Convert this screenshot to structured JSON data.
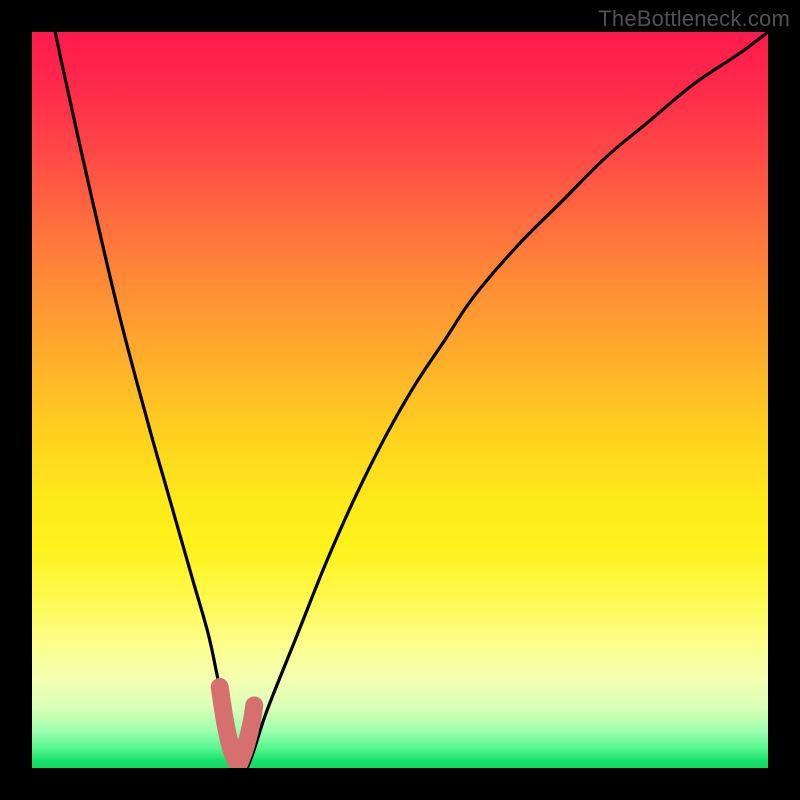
{
  "watermark": "TheBottleneck.com",
  "colors": {
    "frame": "#000000",
    "curve": "#000000",
    "highlight": "#d6706f",
    "gradient_top": "#ff1a4d",
    "gradient_bottom": "#0fdc63"
  },
  "chart_data": {
    "type": "line",
    "title": "",
    "xlabel": "",
    "ylabel": "",
    "xlim": [
      0,
      100
    ],
    "ylim": [
      0,
      100
    ],
    "grid": false,
    "x": [
      0,
      4,
      8,
      12,
      16,
      18,
      20,
      22,
      24,
      25.5,
      27,
      28,
      29,
      30,
      32,
      36,
      40,
      44,
      48,
      52,
      56,
      60,
      66,
      72,
      78,
      84,
      90,
      96,
      100
    ],
    "series": [
      {
        "name": "bottleneck_curve",
        "values": [
          115,
          96,
          78,
          61,
          46,
          39,
          32,
          25,
          18,
          11,
          5,
          2,
          0,
          2,
          8,
          18,
          28,
          37,
          45,
          52,
          58,
          64,
          71,
          77,
          83,
          88,
          93,
          97,
          100
        ]
      }
    ],
    "trough": {
      "x_range": [
        25.5,
        30
      ],
      "y": 0
    },
    "highlight_segment": {
      "x": [
        25.5,
        26.2,
        26.9,
        27.6,
        28,
        28.4,
        29.1,
        29.8,
        30.2
      ],
      "y": [
        11,
        6.5,
        3.2,
        1.2,
        0.5,
        1.2,
        3.2,
        6,
        8.5
      ]
    }
  }
}
